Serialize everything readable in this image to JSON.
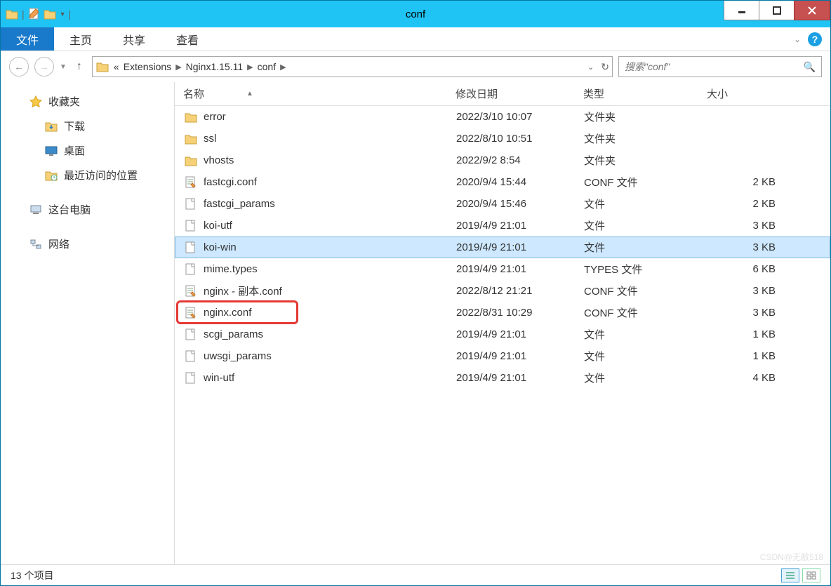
{
  "window": {
    "title": "conf"
  },
  "menu": {
    "file": "文件",
    "home": "主页",
    "share": "共享",
    "view": "查看"
  },
  "breadcrumb": {
    "prefix": "«",
    "parts": [
      "Extensions",
      "Nginx1.15.11",
      "conf"
    ]
  },
  "search": {
    "placeholder": "搜索\"conf\""
  },
  "sidebar": {
    "favorites": "收藏夹",
    "downloads": "下载",
    "desktop": "桌面",
    "recent": "最近访问的位置",
    "thispc": "这台电脑",
    "network": "网络"
  },
  "columns": {
    "name": "名称",
    "date": "修改日期",
    "type": "类型",
    "size": "大小"
  },
  "files": [
    {
      "icon": "folder",
      "name": "error",
      "date": "2022/3/10 10:07",
      "type": "文件夹",
      "size": ""
    },
    {
      "icon": "folder",
      "name": "ssl",
      "date": "2022/8/10 10:51",
      "type": "文件夹",
      "size": ""
    },
    {
      "icon": "folder",
      "name": "vhosts",
      "date": "2022/9/2 8:54",
      "type": "文件夹",
      "size": ""
    },
    {
      "icon": "conf",
      "name": "fastcgi.conf",
      "date": "2020/9/4 15:44",
      "type": "CONF 文件",
      "size": "2 KB"
    },
    {
      "icon": "file",
      "name": "fastcgi_params",
      "date": "2020/9/4 15:46",
      "type": "文件",
      "size": "2 KB"
    },
    {
      "icon": "file",
      "name": "koi-utf",
      "date": "2019/4/9 21:01",
      "type": "文件",
      "size": "3 KB"
    },
    {
      "icon": "file",
      "name": "koi-win",
      "date": "2019/4/9 21:01",
      "type": "文件",
      "size": "3 KB",
      "selected": true
    },
    {
      "icon": "file",
      "name": "mime.types",
      "date": "2019/4/9 21:01",
      "type": "TYPES 文件",
      "size": "6 KB"
    },
    {
      "icon": "conf",
      "name": "nginx - 副本.conf",
      "date": "2022/8/12 21:21",
      "type": "CONF 文件",
      "size": "3 KB"
    },
    {
      "icon": "conf",
      "name": "nginx.conf",
      "date": "2022/8/31 10:29",
      "type": "CONF 文件",
      "size": "3 KB",
      "highlighted": true
    },
    {
      "icon": "file",
      "name": "scgi_params",
      "date": "2019/4/9 21:01",
      "type": "文件",
      "size": "1 KB"
    },
    {
      "icon": "file",
      "name": "uwsgi_params",
      "date": "2019/4/9 21:01",
      "type": "文件",
      "size": "1 KB"
    },
    {
      "icon": "file",
      "name": "win-utf",
      "date": "2019/4/9 21:01",
      "type": "文件",
      "size": "4 KB"
    }
  ],
  "status": {
    "count": "13 个项目"
  },
  "watermark": "CSDN@无敌518"
}
